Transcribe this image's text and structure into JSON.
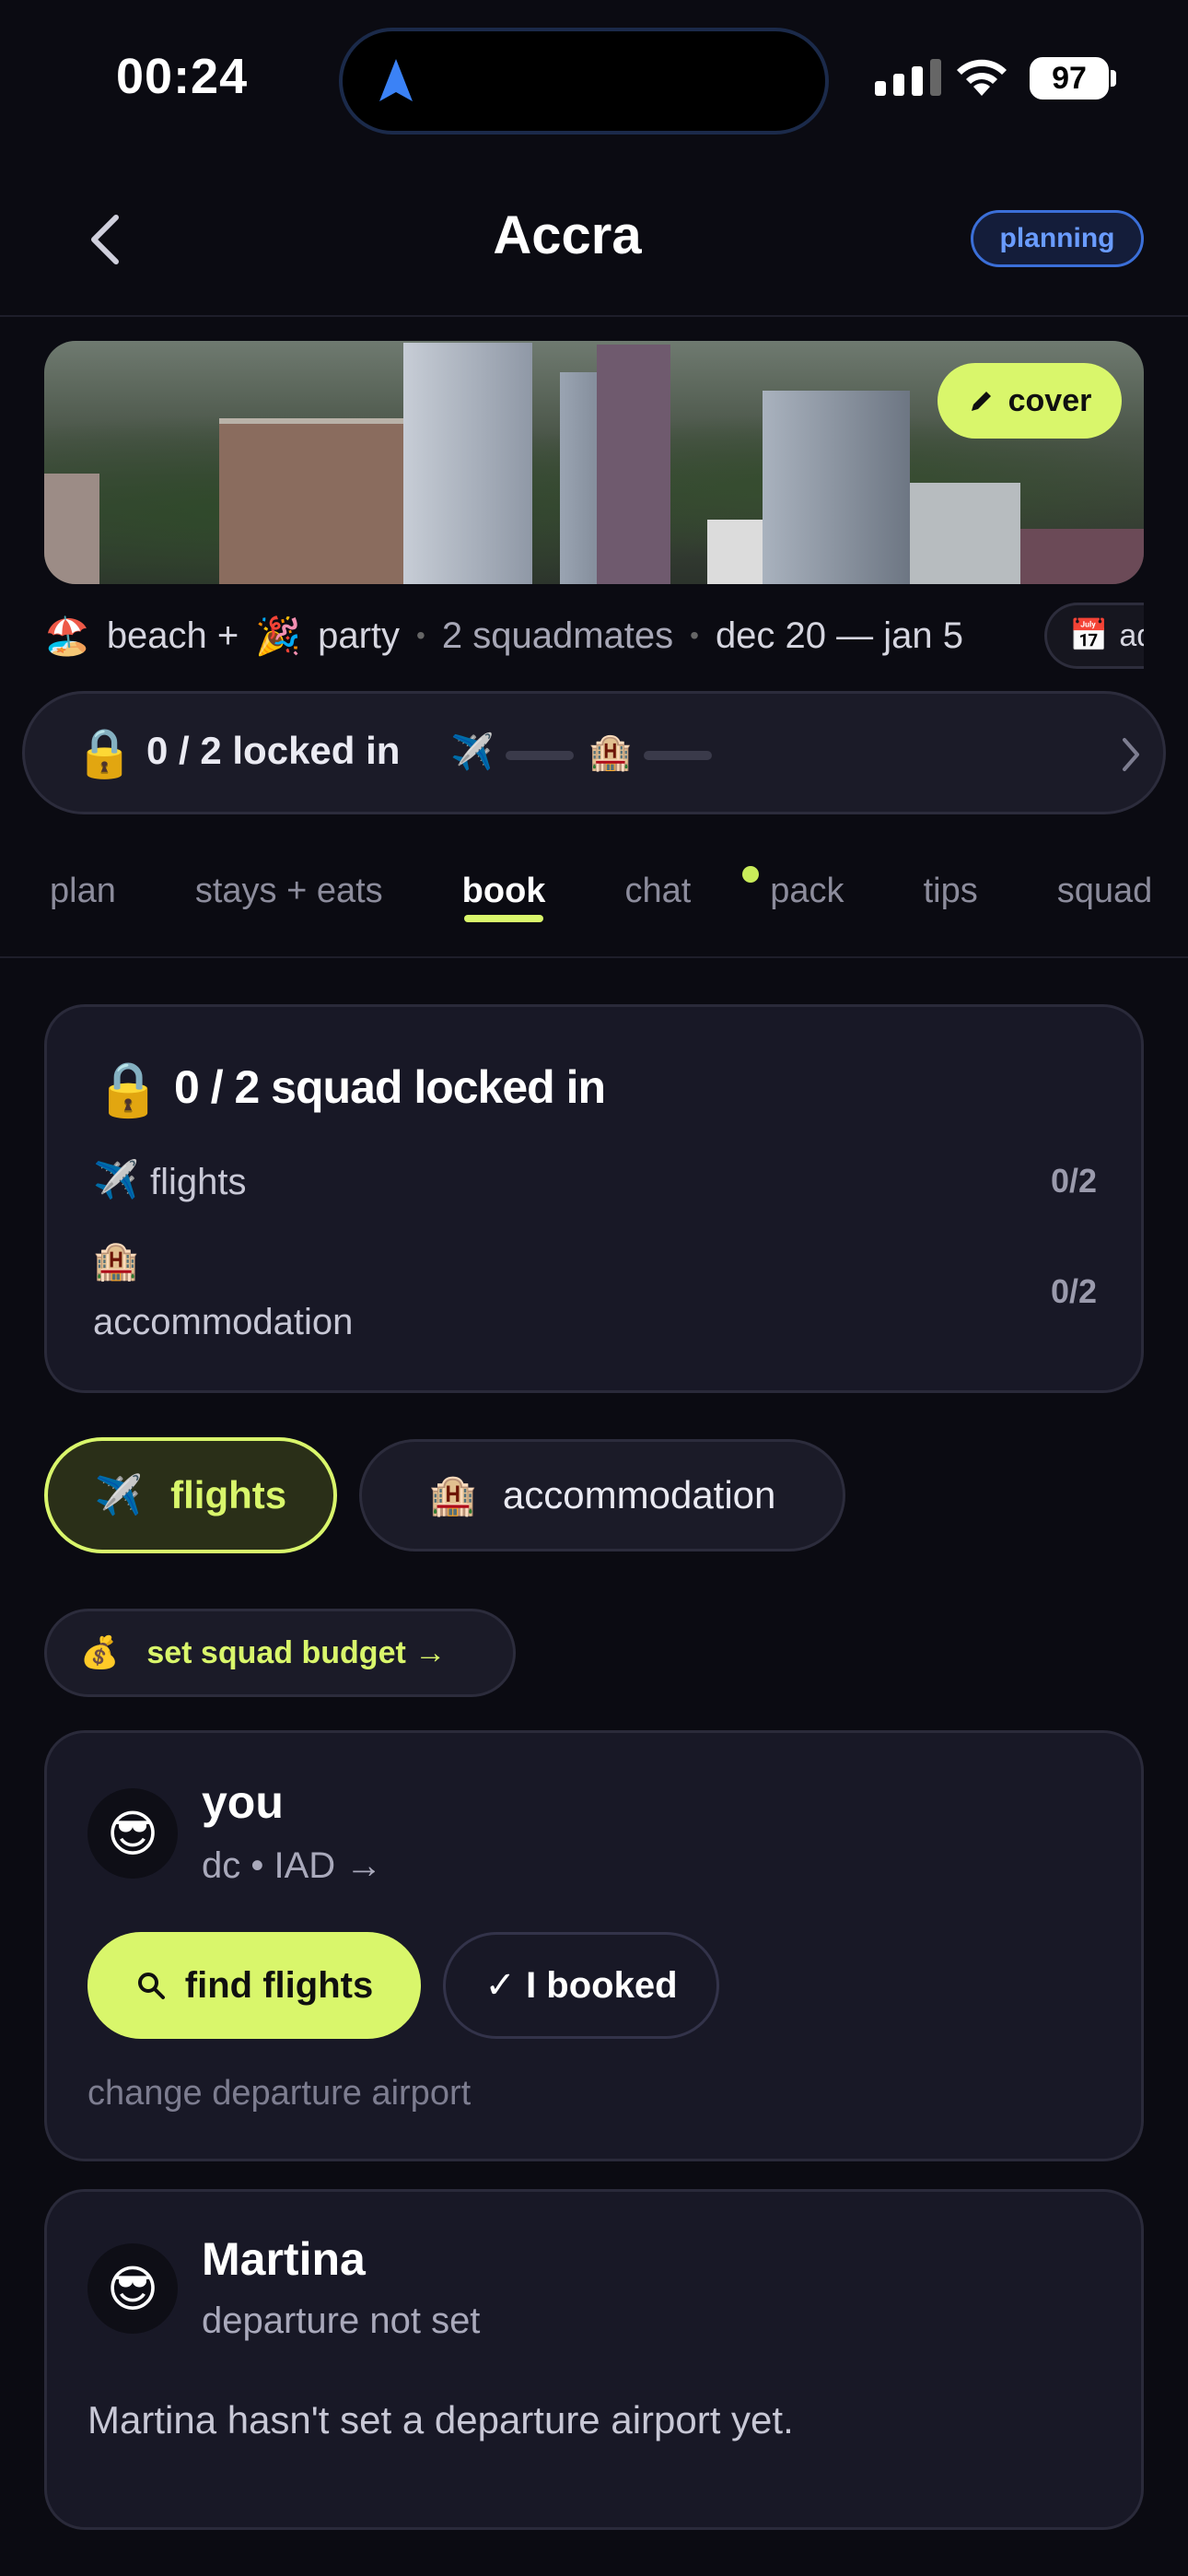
{
  "status": {
    "time": "00:24",
    "battery": "97"
  },
  "header": {
    "title": "Accra",
    "badge": "planning"
  },
  "cover": {
    "button_label": "cover"
  },
  "meta": {
    "emoji_beach": "🏖️",
    "beach": "beach +",
    "emoji_party": "🎉",
    "party": "party",
    "squadmates": "2 squadmates",
    "dates": "dec 20 — jan 5",
    "cal_emoji": "📅",
    "cal_label": "add"
  },
  "locked_bar": {
    "lock_emoji": "🔒",
    "text": "0 / 2 locked in",
    "plane_emoji": "✈️",
    "hotel_emoji": "🏨"
  },
  "tabs": [
    {
      "label": "plan"
    },
    {
      "label": "stays + eats"
    },
    {
      "label": "book"
    },
    {
      "label": "chat"
    },
    {
      "label": "pack"
    },
    {
      "label": "tips"
    },
    {
      "label": "squad"
    }
  ],
  "summary": {
    "lock_emoji": "🔒",
    "title": "0 / 2 squad locked in",
    "rows": [
      {
        "emoji": "✈️",
        "label": "flights",
        "value": "0/2"
      },
      {
        "emoji": "🏨",
        "label": "accommodation",
        "value": "0/2"
      }
    ]
  },
  "toggle": {
    "flights": {
      "emoji": "✈️",
      "label": "flights"
    },
    "accommodation": {
      "emoji": "🏨",
      "label": "accommodation"
    }
  },
  "budget": {
    "emoji": "💰",
    "label": "set squad budget →"
  },
  "members": [
    {
      "avatar": "😎",
      "name": "you",
      "sub": "dc • IAD →",
      "primary_btn": "find flights",
      "secondary_btn": "✓ I booked",
      "link": "change departure airport"
    },
    {
      "avatar": "😎",
      "name": "Martina",
      "sub": "departure not set",
      "note": "Martina hasn't set a departure airport yet."
    }
  ],
  "colors": {
    "accent": "#d9f66b",
    "badge_blue": "#6a9cff",
    "card_bg": "#181826",
    "page_bg": "#0b0b12"
  }
}
